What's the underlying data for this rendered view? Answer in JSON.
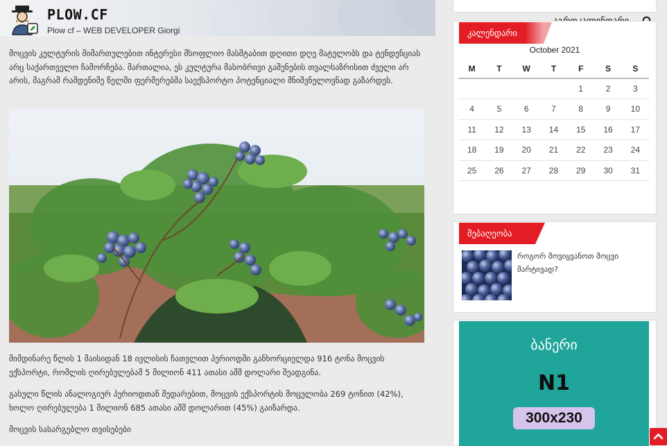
{
  "site": {
    "title": "PLOW.CF",
    "tagline": "Plow cf – WEB DEVELOPER Giorgi"
  },
  "nav": {
    "item": "აგროკალენდარი",
    "search_icon": "search-icon"
  },
  "article": {
    "paragraph1": "მოცვის კულტურის მიმართულებით ინტერესი მსოფლიო მასშტაბით დღითი დღე მატულობს და ტენდენციას არც საქართველო ჩამორჩება. მართალია, ეს კულტურა მასობრივი გაშენების თვალსაზრისით ძველი არ არის, მაგრამ რამდენიმე წელში ფერმერებმა საექსპორტო პოტენციალი მნიშვნელოვნად გაზარდეს.",
    "image_alt": "blueberry bush",
    "paragraph2": "მიმდინარე წლის 1 მაისიდან 18 ივლისის ჩათვლით პერიოდში განხორციელდა 916 ტონა მოცვის ექსპორტი, რომლის ღირებულებამ 5 მილიონ 411 ათასი აშშ დოლარი შეადგინა.",
    "paragraph3": "გასული წლის ანალოგიურ პერიოდთან შედარებით, მოცვის ექსპორტის მოცულობა 269 ტონით (42%), ხოლო ღირებულება 1 მილიონ 685 ათასი აშშ დოლარით (45%) გაიზარდა.",
    "paragraph4": "მოცვის სასარგებლო თვისებები"
  },
  "calendar": {
    "title": "კალენდარი",
    "caption": "October 2021",
    "headers": [
      "M",
      "T",
      "W",
      "T",
      "F",
      "S",
      "S"
    ],
    "rows": [
      [
        "",
        "",
        "",
        "",
        "1",
        "2",
        "3"
      ],
      [
        "4",
        "5",
        "6",
        "7",
        "8",
        "9",
        "10"
      ],
      [
        "11",
        "12",
        "13",
        "14",
        "15",
        "16",
        "17"
      ],
      [
        "18",
        "19",
        "20",
        "21",
        "22",
        "23",
        "24"
      ],
      [
        "25",
        "26",
        "27",
        "28",
        "29",
        "30",
        "31"
      ]
    ]
  },
  "news": {
    "title": "მებაღეობა",
    "item_title": "როგორ მოვიყვანოთ მოცვი მარტივად?"
  },
  "ad": {
    "line1": "ბანერი",
    "line2": "N1",
    "size": "300x230"
  },
  "colors": {
    "accent": "#e31d25",
    "ad_bg": "#1fa59a",
    "ad_badge": "#d7c4ec"
  }
}
